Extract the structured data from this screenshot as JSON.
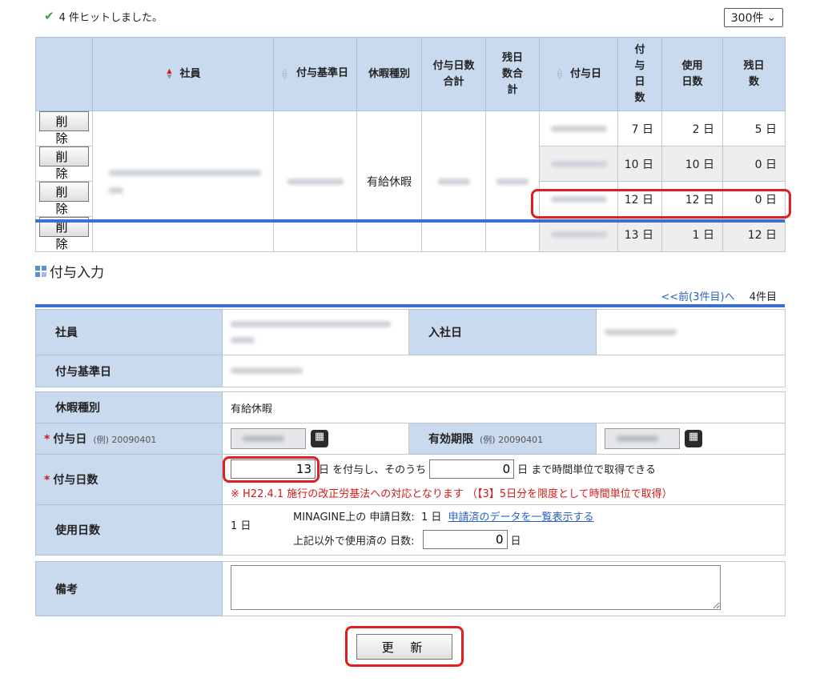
{
  "header": {
    "hits_text": "4 件ヒットしました。",
    "per_page": "300件"
  },
  "list": {
    "columns": [
      "社員",
      "付与基準日",
      "休暇種別",
      "付与日数合計",
      "残日数合計",
      "付与日",
      "付与日数",
      "使用日数",
      "残日数"
    ],
    "delete_label": "削 除",
    "leave_type": "有給休暇",
    "rows": [
      {
        "days": "7 日",
        "used": "2 日",
        "remaining": "5 日"
      },
      {
        "days": "10 日",
        "used": "10 日",
        "remaining": "0 日"
      },
      {
        "days": "12 日",
        "used": "12 日",
        "remaining": "0 日"
      },
      {
        "days": "13 日",
        "used": "1 日",
        "remaining": "12 日"
      }
    ]
  },
  "section": {
    "title": "付与入力"
  },
  "pager": {
    "prev_label": "<<前(3件目)へ",
    "current": "4件目"
  },
  "form": {
    "employee_label": "社員",
    "hire_date_label": "入社日",
    "base_date_label": "付与基準日",
    "leave_type_label": "休暇種別",
    "leave_type_value": "有給休暇",
    "grant_date_label": "付与日",
    "grant_date_example": "(例) 20090401",
    "expiry_label": "有効期限",
    "expiry_example": "(例) 20090401",
    "required_mark": "*",
    "grant_days_label": "付与日数",
    "grant_days_value": "13",
    "grant_text": "日 を付与し、そのうち",
    "hourly_days_value": "0",
    "hourly_text": "日 まで時間単位で取得できる",
    "notice": "※ H22.4.1 施行の改正労基法への対応となります （【3】5日分を限度として時間単位で取得）",
    "used_days_label": "使用日数",
    "used_days_value": "1 日",
    "app_used_label": "MINAGINE上の 申請日数:",
    "app_used_value": "1 日",
    "app_list_link": "申請済のデータを一覧表示する",
    "other_used_label": "上記以外で使用済の 日数:",
    "other_used_value": "0",
    "other_used_unit": "日",
    "memo_label": "備考",
    "memo_value": ""
  },
  "actions": {
    "update_label": "更 新"
  },
  "colors": {
    "header_bg": "#c9d9ee",
    "accent_blue": "#3c6fcf",
    "highlight_red": "#e02020",
    "required_red": "#d21a1a"
  }
}
